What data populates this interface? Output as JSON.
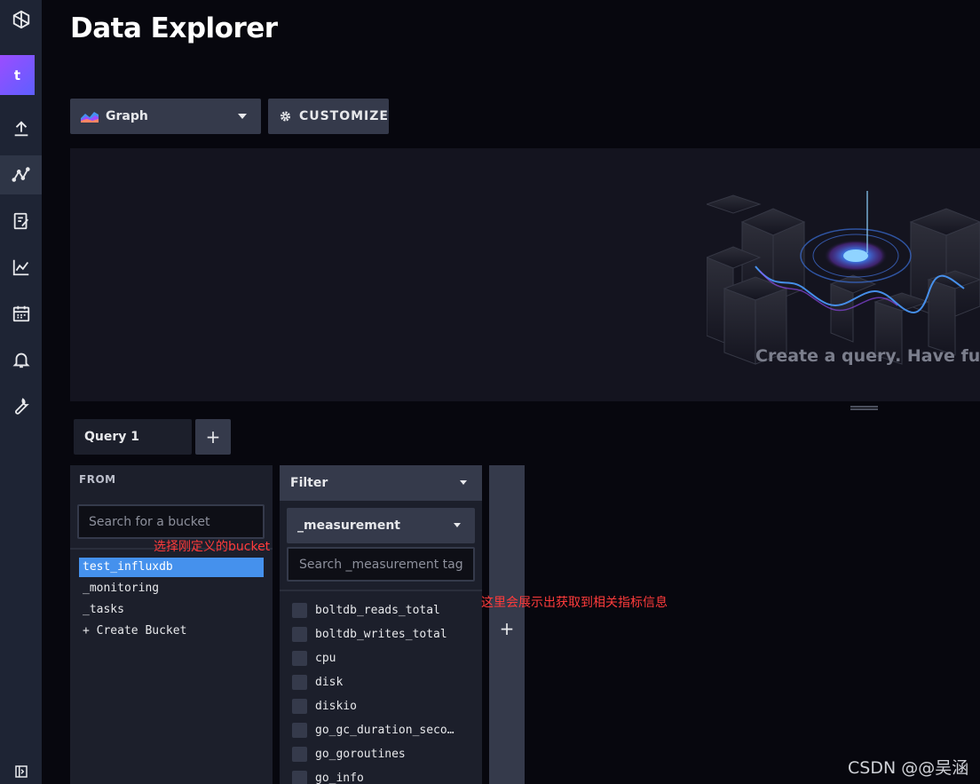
{
  "nav": {
    "items": [
      {
        "icon": "logo-icon"
      },
      {
        "icon": "upload-icon"
      },
      {
        "icon": "data-explorer-icon",
        "active": true
      },
      {
        "icon": "notebook-icon"
      },
      {
        "icon": "dashboard-chart-icon"
      },
      {
        "icon": "calendar-icon"
      },
      {
        "icon": "bell-icon"
      },
      {
        "icon": "wrench-icon"
      },
      {
        "icon": "collapse-icon"
      }
    ],
    "avatar_letter": "t"
  },
  "page": {
    "title": "Data Explorer"
  },
  "toolbar": {
    "graph_type_label": "Graph",
    "customize_label": "CUSTOMIZE"
  },
  "graph": {
    "empty_message": "Create a query. Have fun!"
  },
  "queries": {
    "tabs": [
      {
        "label": "Query 1"
      }
    ],
    "add_label": "+"
  },
  "from": {
    "label": "FROM",
    "search_placeholder": "Search for a bucket",
    "buckets": [
      {
        "label": "test_influxdb",
        "selected": true
      },
      {
        "label": "_monitoring",
        "selected": false
      },
      {
        "label": "_tasks",
        "selected": false
      },
      {
        "label": "+ Create Bucket",
        "selected": false
      }
    ]
  },
  "filter": {
    "header_label": "Filter",
    "key_select_label": "_measurement",
    "search_placeholder": "Search _measurement tag",
    "tags": [
      {
        "label": "boltdb_reads_total"
      },
      {
        "label": "boltdb_writes_total"
      },
      {
        "label": "cpu"
      },
      {
        "label": "disk"
      },
      {
        "label": "diskio"
      },
      {
        "label": "go_gc_duration_seco…"
      },
      {
        "label": "go_goroutines"
      },
      {
        "label": "go_info"
      }
    ],
    "add_filter_label": "+"
  },
  "annotations": {
    "bucket_note": "选择刚定义的bucket",
    "metric_note": "这里会展示出获取到相关指标信息"
  },
  "watermark": "CSDN @@吴涵",
  "colors": {
    "accent": "#4591ed",
    "nav_bg": "#1e2434",
    "panel_bg": "#1c1f2b",
    "button_bg": "#353a4b",
    "annotation": "#ff3b3b"
  }
}
